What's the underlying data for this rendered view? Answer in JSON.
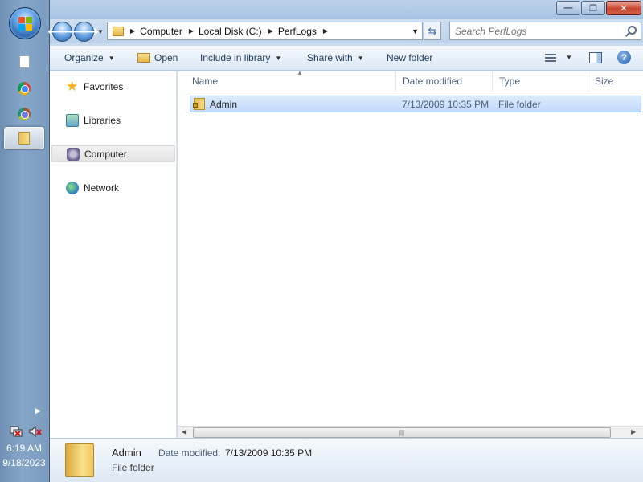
{
  "taskbar": {
    "clock_time": "6:19 AM",
    "clock_date": "9/18/2023",
    "apps": [
      "blank-document",
      "chrome",
      "chrome-canary",
      "windows-explorer"
    ]
  },
  "window": {
    "caption": {
      "minimize": "—",
      "maximize": "❐",
      "close": "✕"
    },
    "address": {
      "crumbs": [
        "Computer",
        "Local Disk (C:)",
        "PerfLogs"
      ]
    },
    "search_placeholder": "Search PerfLogs",
    "toolbar": {
      "organize": "Organize",
      "open": "Open",
      "include_in_library": "Include in library",
      "share_with": "Share with",
      "new_folder": "New folder"
    },
    "navpane": {
      "favorites": "Favorites",
      "libraries": "Libraries",
      "computer": "Computer",
      "network": "Network"
    },
    "columns": {
      "name": "Name",
      "date_modified": "Date modified",
      "type": "Type",
      "size": "Size"
    },
    "files": [
      {
        "name": "Admin",
        "date_modified": "7/13/2009 10:35 PM",
        "type": "File folder",
        "size": ""
      }
    ],
    "details": {
      "name": "Admin",
      "type": "File folder",
      "modified_label": "Date modified:",
      "modified_value": "7/13/2009 10:35 PM"
    }
  },
  "colors": {
    "selection": "#c1dbfc",
    "selection_border": "#84acdd",
    "taskbar": "#7b9bbf",
    "close_button": "#c7452f"
  }
}
